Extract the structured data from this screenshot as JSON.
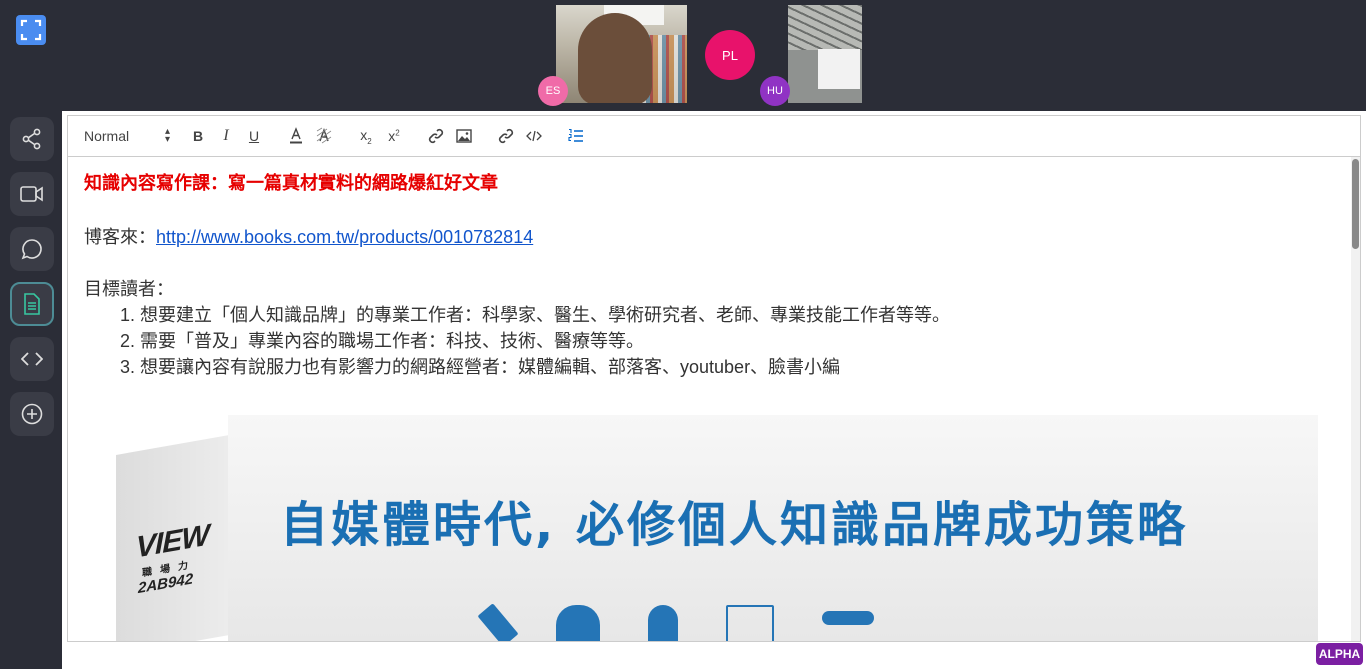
{
  "participants": [
    {
      "initials": "ES",
      "color": "#f06ba8"
    },
    {
      "initials": "PL",
      "color": "#e8126b"
    },
    {
      "initials": "HU",
      "color": "#9033c4"
    }
  ],
  "sidebar": {
    "items": [
      {
        "icon": "share-icon"
      },
      {
        "icon": "video-icon"
      },
      {
        "icon": "chat-icon"
      },
      {
        "icon": "document-icon",
        "active": true
      },
      {
        "icon": "code-icon"
      },
      {
        "icon": "add-icon"
      }
    ]
  },
  "toolbar": {
    "format_select": "Normal"
  },
  "document": {
    "title": "知識內容寫作課：寫一篇真材實料的網路爆紅好文章",
    "source_label": "博客來：",
    "source_link": "http://www.books.com.tw/products/0010782814",
    "audience_label": "目標讀者：",
    "audience": [
      "1. 想要建立「個人知識品牌」的專業工作者：科學家、醫生、學術研究者、老師、專業技能工作者等等。",
      "2. 需要「普及」專業內容的職場工作者：科技、技術、醫療等等。",
      "3. 想要讓內容有說服力也有影響力的網路經營者：媒體編輯、部落客、youtuber、臉書小編"
    ]
  },
  "book_image": {
    "logo": "VIEW",
    "logo_sub": "職場力",
    "code": "2AB942",
    "heading": "自媒體時代, 必修個人知識品牌成功策略"
  },
  "badge": {
    "label": "ALPHA"
  }
}
